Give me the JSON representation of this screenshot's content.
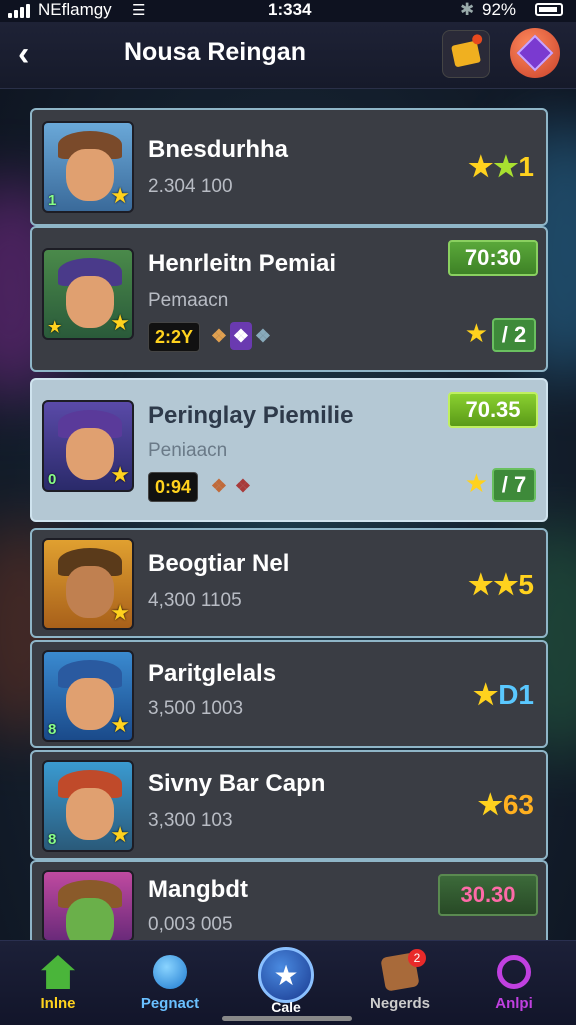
{
  "status_bar": {
    "carrier": "NEflamgy",
    "time": "1:334",
    "battery": "92%"
  },
  "nav": {
    "back_icon": "chevron-left",
    "title": "Nousa Reingan",
    "mail_icon": "envelope",
    "gem_icon": "gem"
  },
  "items": [
    {
      "name": "Bnesdurhha",
      "sub": "2.304 100",
      "rating": "1",
      "stars": 2
    },
    {
      "name": "Henrleitn Pemiai",
      "sub": "Pemaacn",
      "price": "70:30",
      "timer": "2:2Y",
      "badge": "2"
    },
    {
      "name": "Peringlay Piemilie",
      "sub": "Peniaacn",
      "price": "70.35",
      "timer": "0:94",
      "badge": "7",
      "selected": true
    },
    {
      "name": "Beogtiar Nel",
      "sub": "4,300 1105",
      "rating": "5",
      "stars": 2
    },
    {
      "name": "Paritglelals",
      "sub": "3,500 1003",
      "rating": "D1",
      "stars": 1
    },
    {
      "name": "Sivny Bar Capn",
      "sub": "3,300 103",
      "rating": "63",
      "stars": 1
    },
    {
      "name": "Mangbdt",
      "sub": "0,003 005",
      "price": "30.30"
    }
  ],
  "tabs": [
    {
      "label": "Inlne",
      "icon": "home-icon"
    },
    {
      "label": "Pegnact",
      "icon": "orb-icon"
    },
    {
      "label": "Cale",
      "icon": "star-icon"
    },
    {
      "label": "Negerds",
      "icon": "reward-box-icon",
      "badge": "2"
    },
    {
      "label": "Anlpi",
      "icon": "search-icon"
    }
  ],
  "colors": {
    "card": "#3a3d44",
    "card_border": "#8fb6c8",
    "selected_card": "#b4c8d4",
    "star": "#ffd21e",
    "price_green": "#5aa83a"
  }
}
